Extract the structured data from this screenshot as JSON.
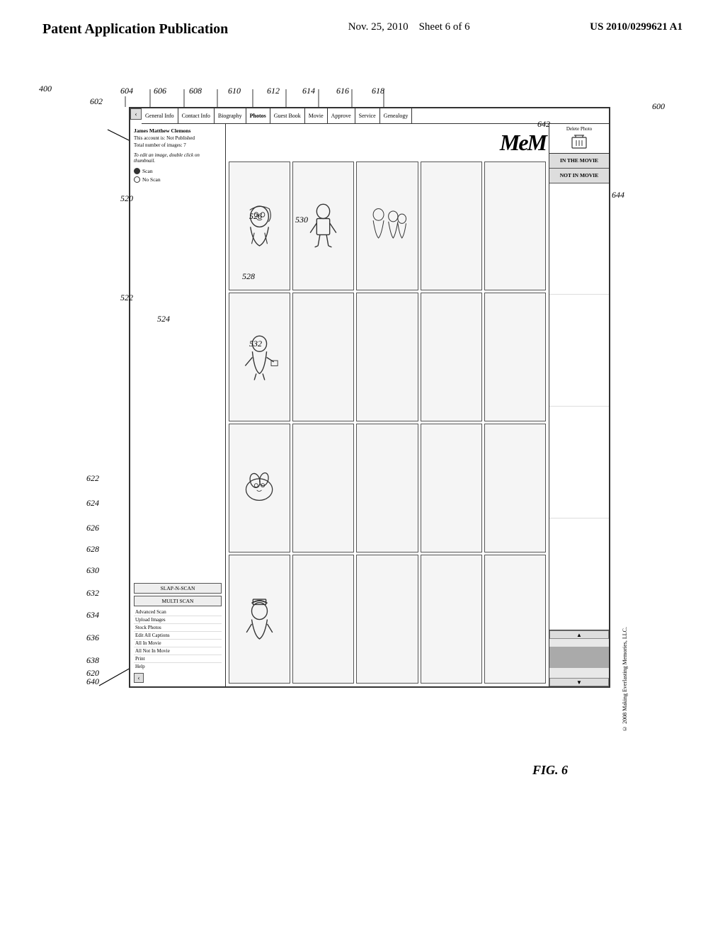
{
  "header": {
    "title": "Patent Application Publication",
    "date": "Nov. 25, 2010",
    "sheet": "Sheet 6 of 6",
    "patent_num": "US 2010/0299621 A1"
  },
  "figure": {
    "label": "FIG. 6",
    "number": "600",
    "copyright": "© 2008 Making Everlasting Memories, LLC."
  },
  "ui": {
    "mem_logo": "MeM",
    "tabs": [
      {
        "label": "General Info",
        "id": "602"
      },
      {
        "label": "Contact Info",
        "id": "604"
      },
      {
        "label": "Biography",
        "id": "606"
      },
      {
        "label": "Photos",
        "id": "608"
      },
      {
        "label": "Guest Book",
        "id": "610"
      },
      {
        "label": "Movie",
        "id": "612"
      },
      {
        "label": "Approve",
        "id": "614"
      },
      {
        "label": "Service",
        "id": "616"
      },
      {
        "label": "Genealogy",
        "id": "618"
      }
    ],
    "left_panel": {
      "account_name": "James Matthew Clemons",
      "account_status": "This account is: Not Published",
      "image_count": "Total number of images: 7",
      "scan_label": "Scan",
      "no_scan_label": "No Scan",
      "scan_id": "522",
      "no_scan_id": "524",
      "edit_hint": "To edit an image, double click on thumbnail."
    },
    "thumbnails_ref": "520",
    "bottom_buttons": [
      {
        "label": "SLAP-N-SCAN",
        "id": "622"
      },
      {
        "label": "MULTI SCAN",
        "id": "624"
      },
      {
        "label": "Advanced Scan",
        "id": "626"
      },
      {
        "label": "Upload Images",
        "id": "628"
      },
      {
        "label": "Stock Photos",
        "id": "630"
      },
      {
        "label": "Edit All Captions",
        "id": "632"
      },
      {
        "label": "All In Movie",
        "id": "634"
      },
      {
        "label": "All Not In Movie",
        "id": "636"
      },
      {
        "label": "Print",
        "id": "638"
      },
      {
        "label": "Help",
        "id": "640"
      }
    ],
    "right_panel": {
      "delete_photo": "Delete Photo",
      "ref_644": "644",
      "in_movie": "IN THE MOVIE",
      "not_in_movie": "NOT IN MOVIE"
    },
    "thumb_530_id": "530",
    "thumb_532_id": "532",
    "thumb_526_id": "526",
    "thumb_528_id": "528"
  },
  "ref_numbers": {
    "r400": "400",
    "r600": "600",
    "r602": "602",
    "r604": "604",
    "r606": "606",
    "r608": "608",
    "r610": "610",
    "r612": "612",
    "r614": "614",
    "r616": "616",
    "r618": "618",
    "r620": "620",
    "r622": "622",
    "r624": "624",
    "r626": "626",
    "r628": "628",
    "r630": "630",
    "r632": "632",
    "r634": "634",
    "r636": "636",
    "r638": "638",
    "r640": "640",
    "r642": "642",
    "r644": "644",
    "r520": "520",
    "r522": "522",
    "r524": "524",
    "r526": "526",
    "r528": "528",
    "r530": "530",
    "r532": "532"
  }
}
